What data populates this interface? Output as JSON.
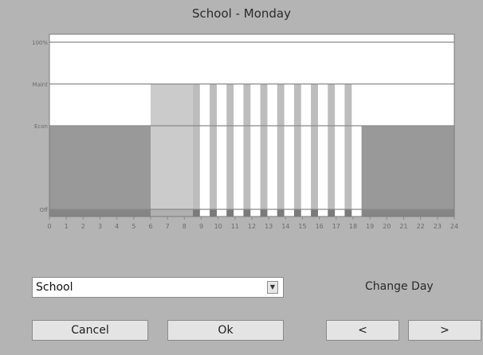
{
  "window": {
    "title": "School - Monday"
  },
  "chart_data": {
    "type": "area",
    "x_ticks": [
      "0",
      "1",
      "2",
      "3",
      "4",
      "5",
      "6",
      "7",
      "8",
      "9",
      "10",
      "11",
      "12",
      "13",
      "14",
      "15",
      "16",
      "17",
      "18",
      "19",
      "20",
      "21",
      "22",
      "23",
      "24"
    ],
    "y_levels": [
      {
        "label": "100%",
        "value": 1.0
      },
      {
        "label": "Maint",
        "value": 0.75
      },
      {
        "label": "Econ",
        "value": 0.5
      },
      {
        "label": "Off",
        "value": 0.0
      }
    ],
    "xlim": [
      0,
      24
    ],
    "schedule": [
      {
        "start": 0,
        "end": 6,
        "level": "Econ"
      },
      {
        "start": 6,
        "end": 8.5,
        "level": "Maint",
        "style": "light"
      },
      {
        "start": 8.5,
        "end": 18.5,
        "level": "Maint",
        "style": "striped"
      },
      {
        "start": 18.5,
        "end": 24,
        "level": "Econ"
      }
    ],
    "colors": {
      "chart_bg": "#ffffff",
      "econ_fill": "#999999",
      "maint_fill": "#cbcbcb",
      "stripe": "#bdbdbd",
      "marker": "#7a7a7a",
      "grid": "#8a8a8a"
    }
  },
  "schedule_select": {
    "value": "School"
  },
  "change_day_label": "Change Day",
  "buttons": {
    "cancel": "Cancel",
    "ok": "Ok",
    "prev": "<",
    "next": ">"
  }
}
